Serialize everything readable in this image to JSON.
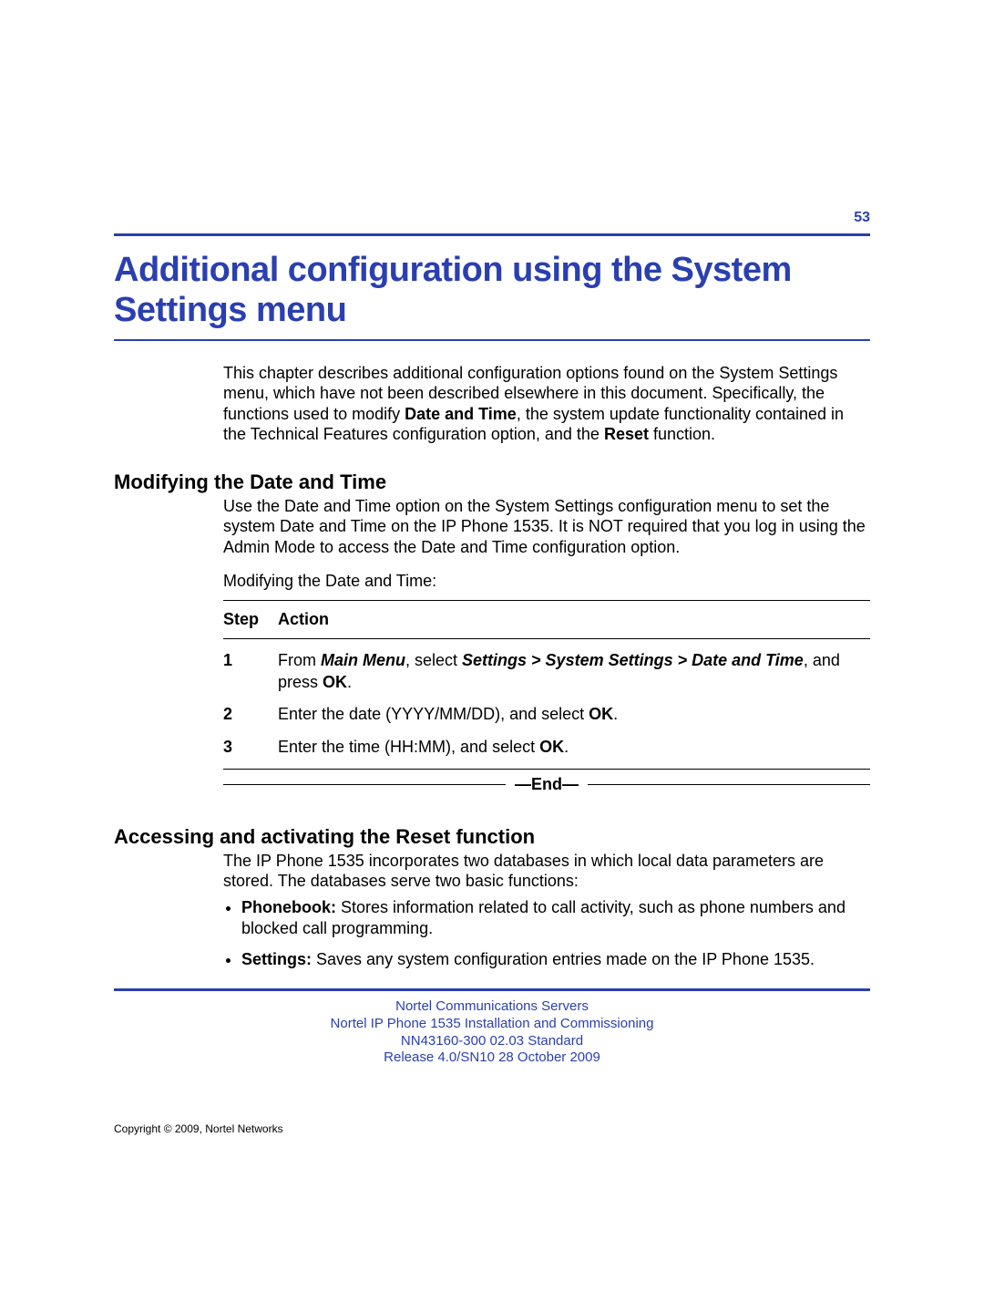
{
  "page_number": "53",
  "title": "Additional configuration using the System Settings menu",
  "intro_parts": {
    "pre1": "This chapter describes additional configuration options found on the System Settings menu, which have not been described elsewhere in this document. Specifically, the functions used to modify ",
    "bold1": "Date and Time",
    "mid1": ", the system update functionality contained in the Technical Features configuration option, and the ",
    "bold2": "Reset",
    "post1": " function."
  },
  "section1": {
    "heading": "Modifying the Date and Time",
    "body": "Use the Date and Time option on the System Settings configuration menu to set the system Date and Time on the IP Phone 1535. It is NOT required that you log in using the Admin Mode to access the Date and Time configuration option.",
    "proc_label": "Modifying the Date and Time:",
    "header_step": "Step",
    "header_action": "Action",
    "steps": [
      {
        "num": "1",
        "pre": "From ",
        "b1": "Main Menu",
        "mid": ", select ",
        "bi1": "Settings > System Settings > Date and Time",
        "mid2": ", and press ",
        "b2": "OK",
        "post": "."
      },
      {
        "num": "2",
        "pre": "Enter the date (YYYY/MM/DD), and select ",
        "b1": "OK",
        "post": "."
      },
      {
        "num": "3",
        "pre": "Enter the time (HH:MM), and select ",
        "b1": "OK",
        "post": "."
      }
    ],
    "end_label": "—End—"
  },
  "section2": {
    "heading": "Accessing and activating the Reset function",
    "body": "The IP Phone 1535 incorporates two databases in which local data parameters are stored. The databases serve two basic functions:",
    "bullets": [
      {
        "b": "Phonebook:",
        "text": " Stores information related to call activity, such as phone numbers and blocked call programming."
      },
      {
        "b": "Settings:",
        "text": " Saves any system configuration entries made on the IP Phone 1535."
      }
    ]
  },
  "footer": {
    "line1": "Nortel Communications Servers",
    "line2": "Nortel IP Phone 1535 Installation and Commissioning",
    "line3": "NN43160-300   02.03   Standard",
    "line4": "Release 4.0/SN10   28 October 2009",
    "copyright": "Copyright © 2009, Nortel Networks"
  }
}
